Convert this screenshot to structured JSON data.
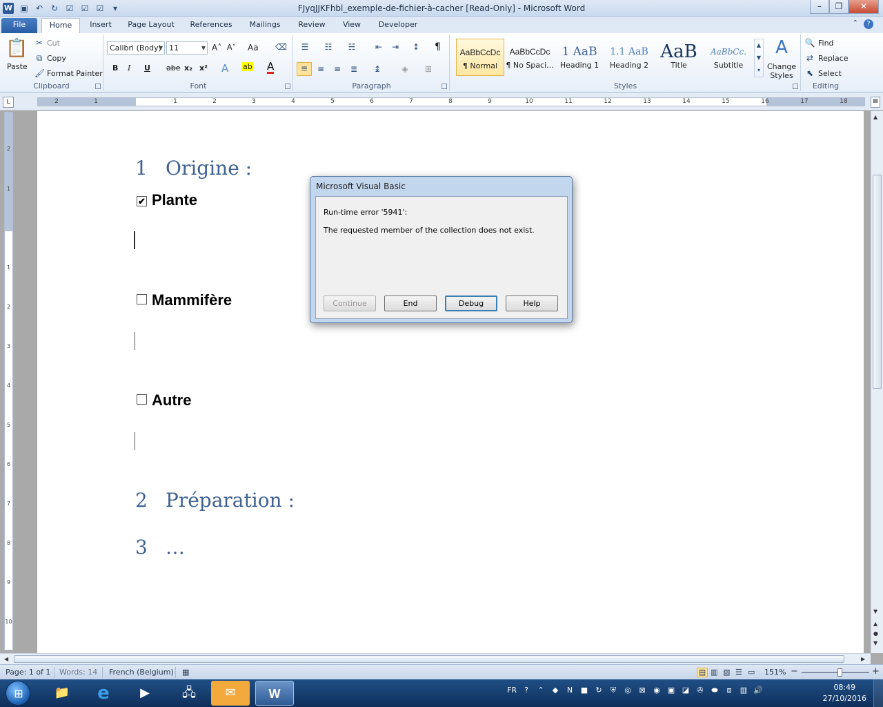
{
  "window": {
    "title": "FJyqJJKFhbl_exemple-de-fichier-à-cacher [Read-Only]  -  Microsoft Word",
    "logo": "W",
    "controls": [
      "–",
      "❐",
      "✕"
    ]
  },
  "tabs": [
    "File",
    "Home",
    "Insert",
    "Page Layout",
    "References",
    "Mailings",
    "Review",
    "View",
    "Developer"
  ],
  "active_tab": "Home",
  "clipboard": {
    "paste": "Paste",
    "cut": "Cut",
    "copy": "Copy",
    "format_painter": "Format Painter",
    "label": "Clipboard"
  },
  "font": {
    "name": "Calibri (Body)",
    "size": "11",
    "grow": "A˄",
    "shrink": "A˅",
    "change_case": "Aa",
    "bold": "B",
    "italic": "I",
    "underline": "U",
    "strike": "abe",
    "subscript": "x₂",
    "superscript": "x²",
    "text_effects": "A",
    "highlight": "ab",
    "font_color": "A",
    "label": "Font"
  },
  "paragraph": {
    "pilcrow": "¶",
    "label": "Paragraph"
  },
  "styles": {
    "items": [
      {
        "sample": "AaBbCcDc",
        "name": "¶ Normal"
      },
      {
        "sample": "AaBbCcDc",
        "name": "¶ No Spaci..."
      },
      {
        "sample": "1  AaB",
        "name": "Heading 1"
      },
      {
        "sample": "1.1  AaB",
        "name": "Heading 2"
      },
      {
        "sample": "AaB",
        "name": "Title"
      },
      {
        "sample": "AaBbCc.",
        "name": "Subtitle"
      }
    ],
    "change_styles": "Change Styles",
    "label": "Styles"
  },
  "editing": {
    "find": "Find",
    "replace": "Replace",
    "select": "Select",
    "label": "Editing"
  },
  "ruler_numbers": [
    "2",
    "1",
    "1",
    "2",
    "3",
    "4",
    "5",
    "6",
    "7",
    "8",
    "9",
    "10",
    "11",
    "12",
    "13",
    "14",
    "15",
    "16",
    "17",
    "18"
  ],
  "vruler_numbers": [
    "2",
    "1",
    "1",
    "2",
    "3",
    "4",
    "5",
    "6",
    "7",
    "8",
    "9",
    "10"
  ],
  "document": {
    "headings": [
      {
        "num": "1",
        "text": "Origine :"
      },
      {
        "num": "2",
        "text": "Préparation :"
      },
      {
        "num": "3",
        "text": "…"
      }
    ],
    "checkboxes": [
      {
        "label": "Plante",
        "checked": true,
        "mark": "✔"
      },
      {
        "label": "Mammifère",
        "checked": false,
        "mark": ""
      },
      {
        "label": "Autre",
        "checked": false,
        "mark": ""
      }
    ]
  },
  "dialog": {
    "title": "Microsoft Visual Basic",
    "message1": "Run-time error '5941':",
    "message2": "The requested member of the collection does not exist.",
    "buttons": {
      "continue": "Continue",
      "end": "End",
      "debug": "Debug",
      "help": "Help"
    }
  },
  "status": {
    "page": "Page: 1 of 1",
    "words": "Words: 14",
    "language": "French (Belgium)",
    "zoom": "151%",
    "zoom_minus": "−",
    "zoom_plus": "+"
  },
  "taskbar": {
    "language": "FR",
    "time": "08:49",
    "date": "27/10/2016"
  },
  "colors": {
    "heading": "#3f6292",
    "ribbon_accent": "#2b579a",
    "taskbar": "#1f4f86"
  }
}
